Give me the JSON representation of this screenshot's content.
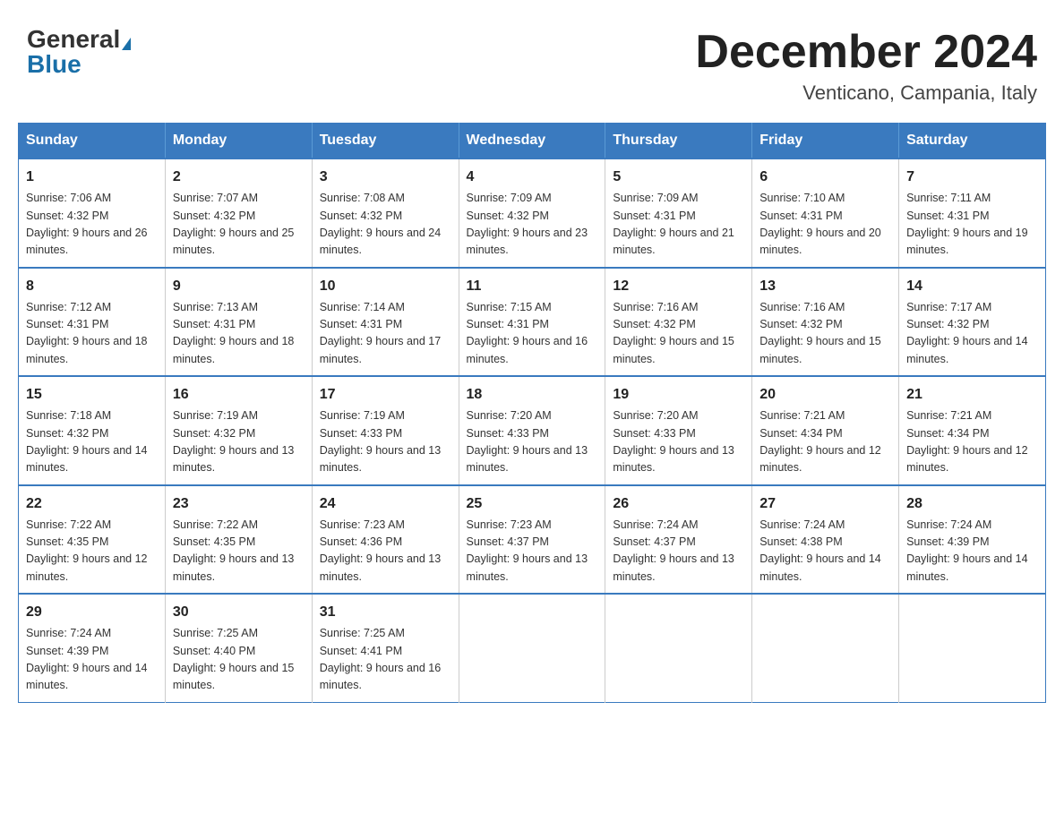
{
  "header": {
    "logo_general": "General",
    "logo_blue": "Blue",
    "month_title": "December 2024",
    "location": "Venticano, Campania, Italy"
  },
  "weekdays": [
    "Sunday",
    "Monday",
    "Tuesday",
    "Wednesday",
    "Thursday",
    "Friday",
    "Saturday"
  ],
  "weeks": [
    [
      {
        "day": "1",
        "sunrise": "7:06 AM",
        "sunset": "4:32 PM",
        "daylight": "9 hours and 26 minutes."
      },
      {
        "day": "2",
        "sunrise": "7:07 AM",
        "sunset": "4:32 PM",
        "daylight": "9 hours and 25 minutes."
      },
      {
        "day": "3",
        "sunrise": "7:08 AM",
        "sunset": "4:32 PM",
        "daylight": "9 hours and 24 minutes."
      },
      {
        "day": "4",
        "sunrise": "7:09 AM",
        "sunset": "4:32 PM",
        "daylight": "9 hours and 23 minutes."
      },
      {
        "day": "5",
        "sunrise": "7:09 AM",
        "sunset": "4:31 PM",
        "daylight": "9 hours and 21 minutes."
      },
      {
        "day": "6",
        "sunrise": "7:10 AM",
        "sunset": "4:31 PM",
        "daylight": "9 hours and 20 minutes."
      },
      {
        "day": "7",
        "sunrise": "7:11 AM",
        "sunset": "4:31 PM",
        "daylight": "9 hours and 19 minutes."
      }
    ],
    [
      {
        "day": "8",
        "sunrise": "7:12 AM",
        "sunset": "4:31 PM",
        "daylight": "9 hours and 18 minutes."
      },
      {
        "day": "9",
        "sunrise": "7:13 AM",
        "sunset": "4:31 PM",
        "daylight": "9 hours and 18 minutes."
      },
      {
        "day": "10",
        "sunrise": "7:14 AM",
        "sunset": "4:31 PM",
        "daylight": "9 hours and 17 minutes."
      },
      {
        "day": "11",
        "sunrise": "7:15 AM",
        "sunset": "4:31 PM",
        "daylight": "9 hours and 16 minutes."
      },
      {
        "day": "12",
        "sunrise": "7:16 AM",
        "sunset": "4:32 PM",
        "daylight": "9 hours and 15 minutes."
      },
      {
        "day": "13",
        "sunrise": "7:16 AM",
        "sunset": "4:32 PM",
        "daylight": "9 hours and 15 minutes."
      },
      {
        "day": "14",
        "sunrise": "7:17 AM",
        "sunset": "4:32 PM",
        "daylight": "9 hours and 14 minutes."
      }
    ],
    [
      {
        "day": "15",
        "sunrise": "7:18 AM",
        "sunset": "4:32 PM",
        "daylight": "9 hours and 14 minutes."
      },
      {
        "day": "16",
        "sunrise": "7:19 AM",
        "sunset": "4:32 PM",
        "daylight": "9 hours and 13 minutes."
      },
      {
        "day": "17",
        "sunrise": "7:19 AM",
        "sunset": "4:33 PM",
        "daylight": "9 hours and 13 minutes."
      },
      {
        "day": "18",
        "sunrise": "7:20 AM",
        "sunset": "4:33 PM",
        "daylight": "9 hours and 13 minutes."
      },
      {
        "day": "19",
        "sunrise": "7:20 AM",
        "sunset": "4:33 PM",
        "daylight": "9 hours and 13 minutes."
      },
      {
        "day": "20",
        "sunrise": "7:21 AM",
        "sunset": "4:34 PM",
        "daylight": "9 hours and 12 minutes."
      },
      {
        "day": "21",
        "sunrise": "7:21 AM",
        "sunset": "4:34 PM",
        "daylight": "9 hours and 12 minutes."
      }
    ],
    [
      {
        "day": "22",
        "sunrise": "7:22 AM",
        "sunset": "4:35 PM",
        "daylight": "9 hours and 12 minutes."
      },
      {
        "day": "23",
        "sunrise": "7:22 AM",
        "sunset": "4:35 PM",
        "daylight": "9 hours and 13 minutes."
      },
      {
        "day": "24",
        "sunrise": "7:23 AM",
        "sunset": "4:36 PM",
        "daylight": "9 hours and 13 minutes."
      },
      {
        "day": "25",
        "sunrise": "7:23 AM",
        "sunset": "4:37 PM",
        "daylight": "9 hours and 13 minutes."
      },
      {
        "day": "26",
        "sunrise": "7:24 AM",
        "sunset": "4:37 PM",
        "daylight": "9 hours and 13 minutes."
      },
      {
        "day": "27",
        "sunrise": "7:24 AM",
        "sunset": "4:38 PM",
        "daylight": "9 hours and 14 minutes."
      },
      {
        "day": "28",
        "sunrise": "7:24 AM",
        "sunset": "4:39 PM",
        "daylight": "9 hours and 14 minutes."
      }
    ],
    [
      {
        "day": "29",
        "sunrise": "7:24 AM",
        "sunset": "4:39 PM",
        "daylight": "9 hours and 14 minutes."
      },
      {
        "day": "30",
        "sunrise": "7:25 AM",
        "sunset": "4:40 PM",
        "daylight": "9 hours and 15 minutes."
      },
      {
        "day": "31",
        "sunrise": "7:25 AM",
        "sunset": "4:41 PM",
        "daylight": "9 hours and 16 minutes."
      },
      null,
      null,
      null,
      null
    ]
  ]
}
